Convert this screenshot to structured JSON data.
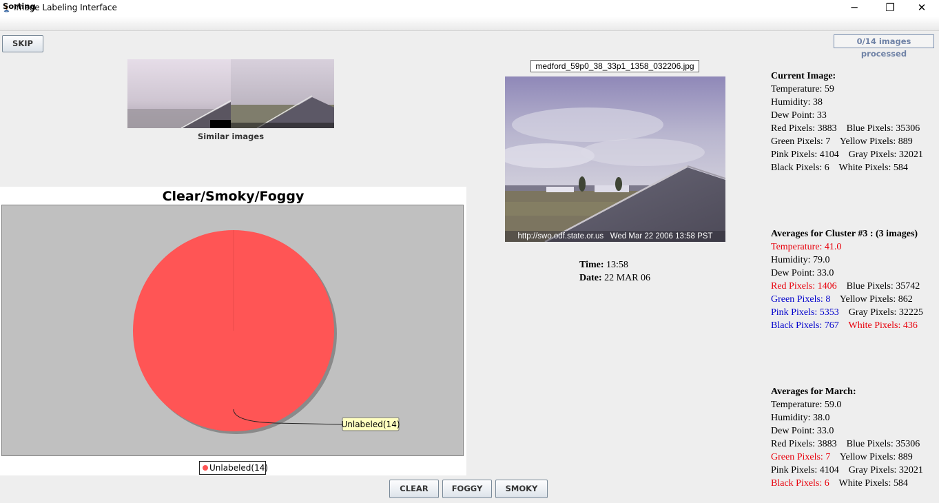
{
  "window": {
    "title": "Image Labeling Interface"
  },
  "menu": {
    "items": [
      "Sorting"
    ]
  },
  "toolbar": {
    "skip_label": "SKIP",
    "progress": "0/14 images processed"
  },
  "similar": {
    "label": "Similar images"
  },
  "chart_data": {
    "type": "pie",
    "title": "Clear/Smoky/Foggy",
    "slices": [
      {
        "label": "Unlabeled(14)",
        "value": 14,
        "color": "#ff5555"
      }
    ],
    "legend": "bottom",
    "plot_background": "#c0c0c0"
  },
  "image": {
    "filename": "medford_59p0_38_33p1_1358_032206.jpg",
    "caption": "http://swo.odf.state.or.us   Wed Mar 22 2006 13:58 PST",
    "time_label": "Time:",
    "time": "13:58",
    "date_label": "Date:",
    "date": "22 MAR 06"
  },
  "current": {
    "title": "Current Image:",
    "temperature": "Temperature: 59",
    "humidity": "Humidity: 38",
    "dew_point": "Dew Point: 33",
    "red": "Red Pixels: 3883",
    "blue": "Blue Pixels: 35306",
    "green": "Green Pixels: 7",
    "yellow": "Yellow Pixels: 889",
    "pink": "Pink Pixels: 4104",
    "gray": "Gray Pixels: 32021",
    "black": "Black Pixels: 6",
    "white": "White Pixels: 584"
  },
  "cluster": {
    "title": "Averages for Cluster #3 : (3 images)",
    "temperature": "Temperature: 41.0",
    "humidity": "Humidity: 79.0",
    "dew_point": "Dew Point: 33.0",
    "red": "Red Pixels: 1406",
    "blue": "Blue Pixels: 35742",
    "green": "Green Pixels: 8",
    "yellow": "Yellow Pixels: 862",
    "pink": "Pink Pixels: 5353",
    "gray": "Gray Pixels: 32225",
    "black": "Black Pixels: 767",
    "white": "White Pixels: 436"
  },
  "march": {
    "title": "Averages for March:",
    "temperature": "Temperature: 59.0",
    "humidity": "Humidity: 38.0",
    "dew_point": "Dew Point: 33.0",
    "red": "Red Pixels: 3883",
    "blue": "Blue Pixels: 35306",
    "green": "Green Pixels: 7",
    "yellow": "Yellow Pixels: 889",
    "pink": "Pink Pixels: 4104",
    "gray": "Gray Pixels: 32021",
    "black": "Black Pixels: 6",
    "white": "White Pixels: 584"
  },
  "buttons": {
    "clear": "CLEAR",
    "foggy": "FOGGY",
    "smoky": "SMOKY"
  },
  "colors": {
    "highlight_red": "#e8000b",
    "highlight_blue": "#0000cc",
    "pie": "#ff5555"
  }
}
